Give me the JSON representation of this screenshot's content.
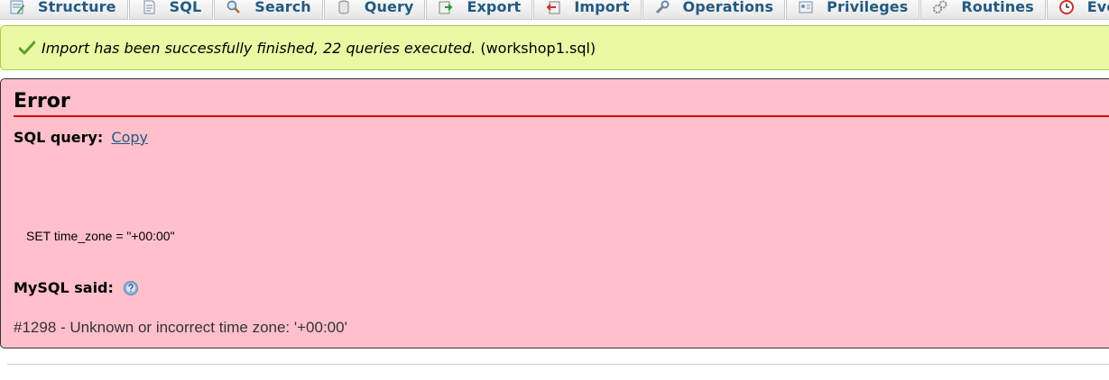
{
  "tabs": [
    {
      "label": "Structure",
      "icon": "structure-icon"
    },
    {
      "label": "SQL",
      "icon": "sql-icon"
    },
    {
      "label": "Search",
      "icon": "search-icon"
    },
    {
      "label": "Query",
      "icon": "query-icon"
    },
    {
      "label": "Export",
      "icon": "export-icon"
    },
    {
      "label": "Import",
      "icon": "import-icon"
    },
    {
      "label": "Operations",
      "icon": "operations-icon"
    },
    {
      "label": "Privileges",
      "icon": "privileges-icon"
    },
    {
      "label": "Routines",
      "icon": "routines-icon"
    },
    {
      "label": "Events",
      "icon": "events-icon"
    }
  ],
  "success": {
    "message": "Import has been successfully finished, 22 queries executed.",
    "file": "(workshop1.sql)"
  },
  "error": {
    "title": "Error",
    "sql_label": "SQL query:",
    "copy_label": "Copy",
    "sql_text": "SET time_zone = \"+00:00\"",
    "mysql_said_label": "MySQL said:",
    "code_message": "#1298 - Unknown or incorrect time zone: '+00:00'"
  },
  "colors": {
    "tab_text": "#235a81",
    "success_bg": "#ebf8a4",
    "error_bg": "#ffc0cb",
    "error_rule": "#e00000"
  }
}
